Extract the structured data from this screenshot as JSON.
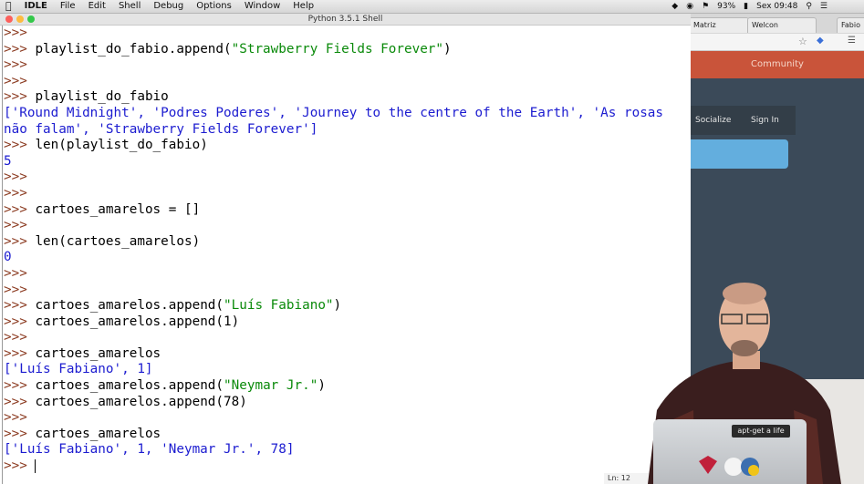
{
  "menubar": {
    "app_name": "IDLE",
    "menus": [
      "File",
      "Edit",
      "Shell",
      "Debug",
      "Options",
      "Window",
      "Help"
    ],
    "battery": "93%",
    "clock": "Sex 09:48"
  },
  "window": {
    "title": "Python 3.5.1 Shell"
  },
  "shell": {
    "lines": [
      [
        {
          "t": ">>> ",
          "c": "prompt"
        }
      ],
      [
        {
          "t": ">>> ",
          "c": "prompt"
        },
        {
          "t": "playlist_do_fabio.append(",
          "c": "code"
        },
        {
          "t": "\"Strawberry Fields Forever\"",
          "c": "str"
        },
        {
          "t": ")",
          "c": "code"
        }
      ],
      [
        {
          "t": ">>> ",
          "c": "prompt"
        }
      ],
      [
        {
          "t": ">>> ",
          "c": "prompt"
        }
      ],
      [
        {
          "t": ">>> ",
          "c": "prompt"
        },
        {
          "t": "playlist_do_fabio",
          "c": "code"
        }
      ],
      [
        {
          "t": "['Round Midnight', 'Podres Poderes', 'Journey to the centre of the Earth', 'As rosas",
          "c": "out"
        }
      ],
      [
        {
          "t": "não falam', 'Strawberry Fields Forever']",
          "c": "out"
        }
      ],
      [
        {
          "t": ">>> ",
          "c": "prompt"
        },
        {
          "t": "len(playlist_do_fabio)",
          "c": "code"
        }
      ],
      [
        {
          "t": "5",
          "c": "out"
        }
      ],
      [
        {
          "t": ">>> ",
          "c": "prompt"
        }
      ],
      [
        {
          "t": ">>> ",
          "c": "prompt"
        }
      ],
      [
        {
          "t": ">>> ",
          "c": "prompt"
        },
        {
          "t": "cartoes_amarelos = []",
          "c": "code"
        }
      ],
      [
        {
          "t": ">>> ",
          "c": "prompt"
        }
      ],
      [
        {
          "t": ">>> ",
          "c": "prompt"
        },
        {
          "t": "len(cartoes_amarelos)",
          "c": "code"
        }
      ],
      [
        {
          "t": "0",
          "c": "out"
        }
      ],
      [
        {
          "t": ">>> ",
          "c": "prompt"
        }
      ],
      [
        {
          "t": ">>> ",
          "c": "prompt"
        }
      ],
      [
        {
          "t": ">>> ",
          "c": "prompt"
        },
        {
          "t": "cartoes_amarelos.append(",
          "c": "code"
        },
        {
          "t": "\"Luís Fabiano\"",
          "c": "str"
        },
        {
          "t": ")",
          "c": "code"
        }
      ],
      [
        {
          "t": ">>> ",
          "c": "prompt"
        },
        {
          "t": "cartoes_amarelos.append(1)",
          "c": "code"
        }
      ],
      [
        {
          "t": ">>> ",
          "c": "prompt"
        }
      ],
      [
        {
          "t": ">>> ",
          "c": "prompt"
        },
        {
          "t": "cartoes_amarelos",
          "c": "code"
        }
      ],
      [
        {
          "t": "['Luís Fabiano', 1]",
          "c": "out"
        }
      ],
      [
        {
          "t": ">>> ",
          "c": "prompt"
        },
        {
          "t": "cartoes_amarelos.append(",
          "c": "code"
        },
        {
          "t": "\"Neymar Jr.\"",
          "c": "str"
        },
        {
          "t": ")",
          "c": "code"
        }
      ],
      [
        {
          "t": ">>> ",
          "c": "prompt"
        },
        {
          "t": "cartoes_amarelos.append(78)",
          "c": "code"
        }
      ],
      [
        {
          "t": ">>> ",
          "c": "prompt"
        }
      ],
      [
        {
          "t": ">>> ",
          "c": "prompt"
        },
        {
          "t": "cartoes_amarelos",
          "c": "code"
        }
      ],
      [
        {
          "t": "['Luís Fabiano', 1, 'Neymar Jr.', 78]",
          "c": "out"
        }
      ],
      [
        {
          "t": ">>> ",
          "c": "prompt"
        }
      ]
    ],
    "status": "Ln: 12"
  },
  "browser": {
    "tabs": [
      "Matriz",
      "Welcon",
      "Fabio"
    ],
    "community": "Community",
    "socialize": "Socialize",
    "sign_in": "Sign In"
  },
  "laptop_sticker": "apt-get a life",
  "colors": {
    "prompt": "#8b3a20",
    "code": "#000000",
    "string": "#0a8a0a",
    "output": "#1c1cd0"
  }
}
